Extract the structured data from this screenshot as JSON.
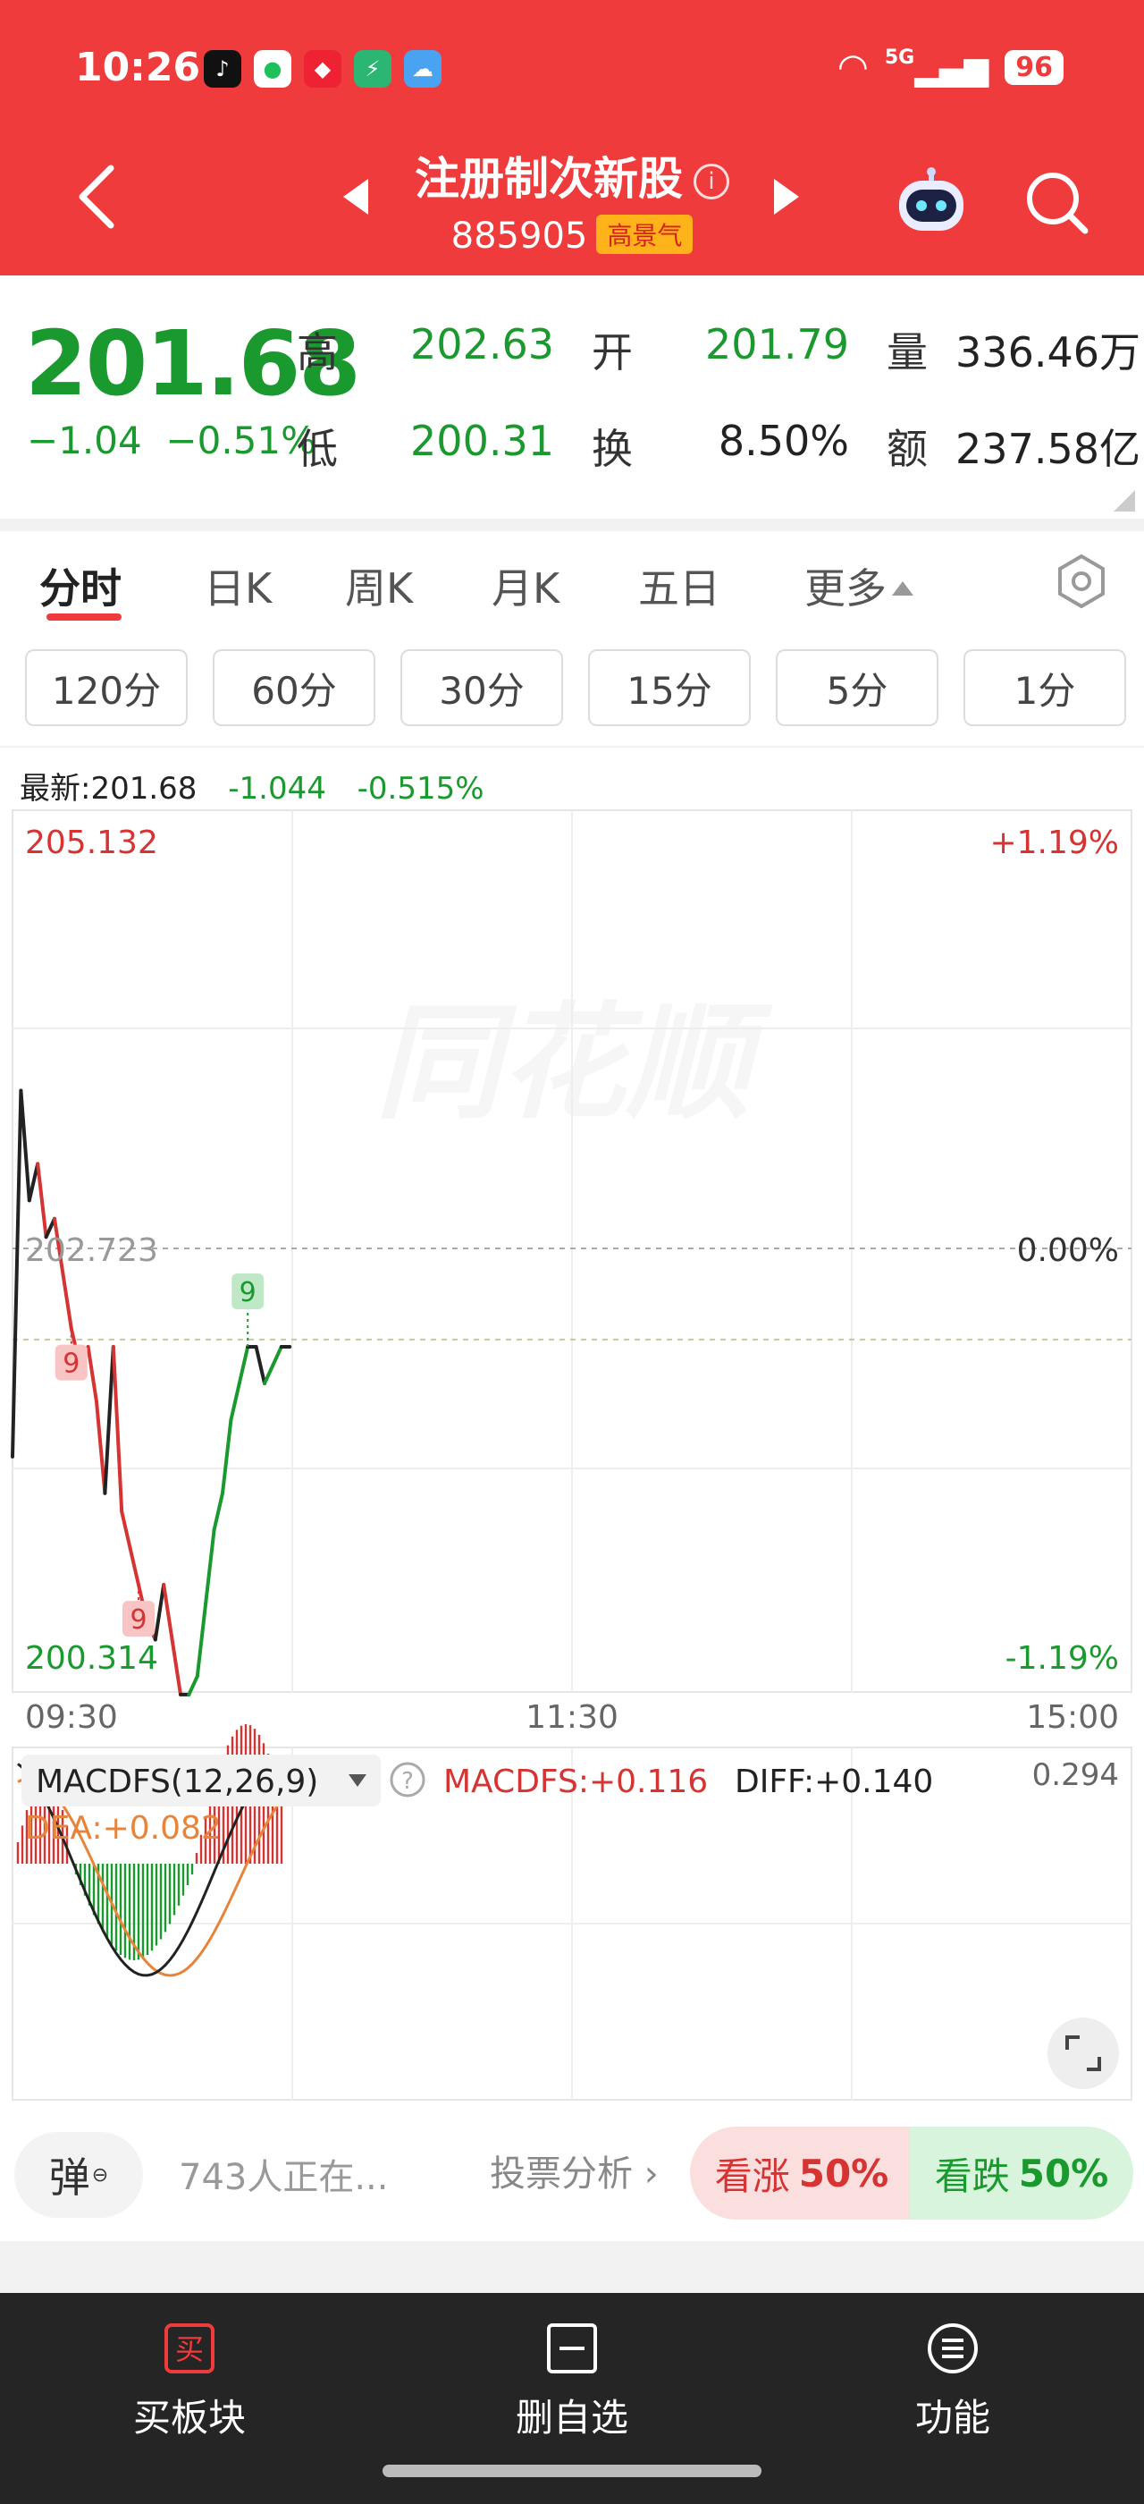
{
  "status_bar": {
    "time": "10:26",
    "network": "5G",
    "battery": "96"
  },
  "header": {
    "title": "注册制次新股",
    "code": "885905",
    "badge": "高景气"
  },
  "quote": {
    "price": "201.68",
    "change": "−1.04",
    "change_pct": "−0.51%",
    "high_label": "高",
    "high": "202.63",
    "open_label": "开",
    "open": "201.79",
    "volume_label": "量",
    "volume": "336.46万",
    "low_label": "低",
    "low": "200.31",
    "turnover_label": "换",
    "turnover": "8.50%",
    "amount_label": "额",
    "amount": "237.58亿"
  },
  "tabs": [
    "分时",
    "日K",
    "周K",
    "月K",
    "五日",
    "更多"
  ],
  "intervals": [
    "120分",
    "60分",
    "30分",
    "15分",
    "5分",
    "1分"
  ],
  "chart_header": {
    "latest": "最新:201.68",
    "change": "-1.044",
    "change_pct": "-0.515%"
  },
  "chart_data": {
    "type": "line",
    "title": "",
    "y_max_label": "205.132",
    "y_mid_label": "202.723",
    "y_min_label": "200.314",
    "pct_max": "+1.19%",
    "pct_mid": "0.00%",
    "pct_min": "-1.19%",
    "x_labels": [
      "09:30",
      "11:30",
      "15:00"
    ],
    "ylim": [
      200.314,
      205.132
    ],
    "avg_price": 202.24,
    "price_series": [
      201.6,
      203.6,
      203.0,
      203.2,
      202.8,
      202.9,
      202.6,
      202.3,
      202.1,
      202.2,
      201.9,
      201.4,
      202.2,
      201.3,
      201.1,
      200.9,
      200.7,
      200.6,
      200.9,
      200.6,
      200.3,
      200.3,
      200.4,
      200.8,
      201.2,
      201.4,
      201.8,
      202.0,
      202.2,
      202.2,
      202.0,
      202.1,
      202.2,
      202.2
    ],
    "signals": [
      {
        "label": "9"
      },
      {
        "label": "9"
      },
      {
        "label": "9"
      }
    ],
    "macd": {
      "name": "MACDFS(12,26,9)",
      "macdfs_label": "MACDFS:+0.116",
      "diff_label": "DIFF:+0.140",
      "dea_label": "DEA:+0.082",
      "scale_label": "0.294"
    }
  },
  "opinion": {
    "danmu": "弹",
    "viewers": "743人正在...",
    "vote_link": "投票分析 ›",
    "bull_label": "看涨",
    "bull_pct": "50%",
    "bear_label": "看跌",
    "bear_pct": "50%"
  },
  "bottom_nav": [
    "买板块",
    "删自选",
    "功能"
  ],
  "colors": {
    "header": "#ef3b3b",
    "up": "#d63333",
    "down": "#1a9a2e"
  }
}
